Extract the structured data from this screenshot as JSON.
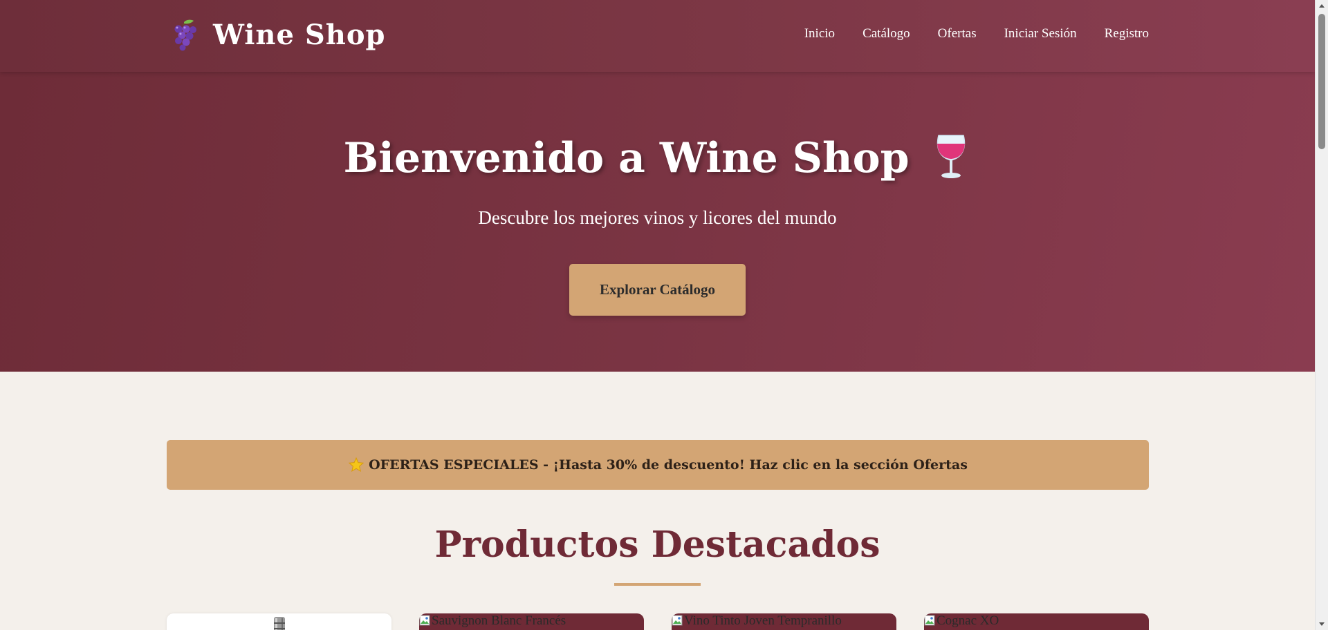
{
  "brand": {
    "name": "Wine Shop",
    "icon": "grapes-icon"
  },
  "nav": {
    "items": [
      "Inicio",
      "Catálogo",
      "Ofertas",
      "Iniciar Sesión",
      "Registro"
    ]
  },
  "hero": {
    "title": "Bienvenido a Wine Shop",
    "title_icon": "wine-glass-icon",
    "subtitle": "Descubre los mejores vinos y licores del mundo",
    "cta_label": "Explorar Catálogo"
  },
  "offer_banner": {
    "icon": "star-icon",
    "text": "OFERTAS ESPECIALES - ¡Hasta 30% de descuento! Haz clic en la sección Ofertas"
  },
  "featured": {
    "title": "Productos Destacados",
    "products": [
      {
        "image_alt": "",
        "image_icon": "bottle-icon"
      },
      {
        "image_alt": "Sauvignon Blanc Francés",
        "image_icon": "broken-image-icon"
      },
      {
        "image_alt": "Vino Tinto Joven Tempranillo",
        "image_icon": "broken-image-icon"
      },
      {
        "image_alt": "Cognac XO",
        "image_icon": "broken-image-icon"
      }
    ]
  },
  "colors": {
    "primary": "#7a3443",
    "accent": "#d3a574",
    "background": "#f4f0eb",
    "heading": "#6f2a36"
  }
}
